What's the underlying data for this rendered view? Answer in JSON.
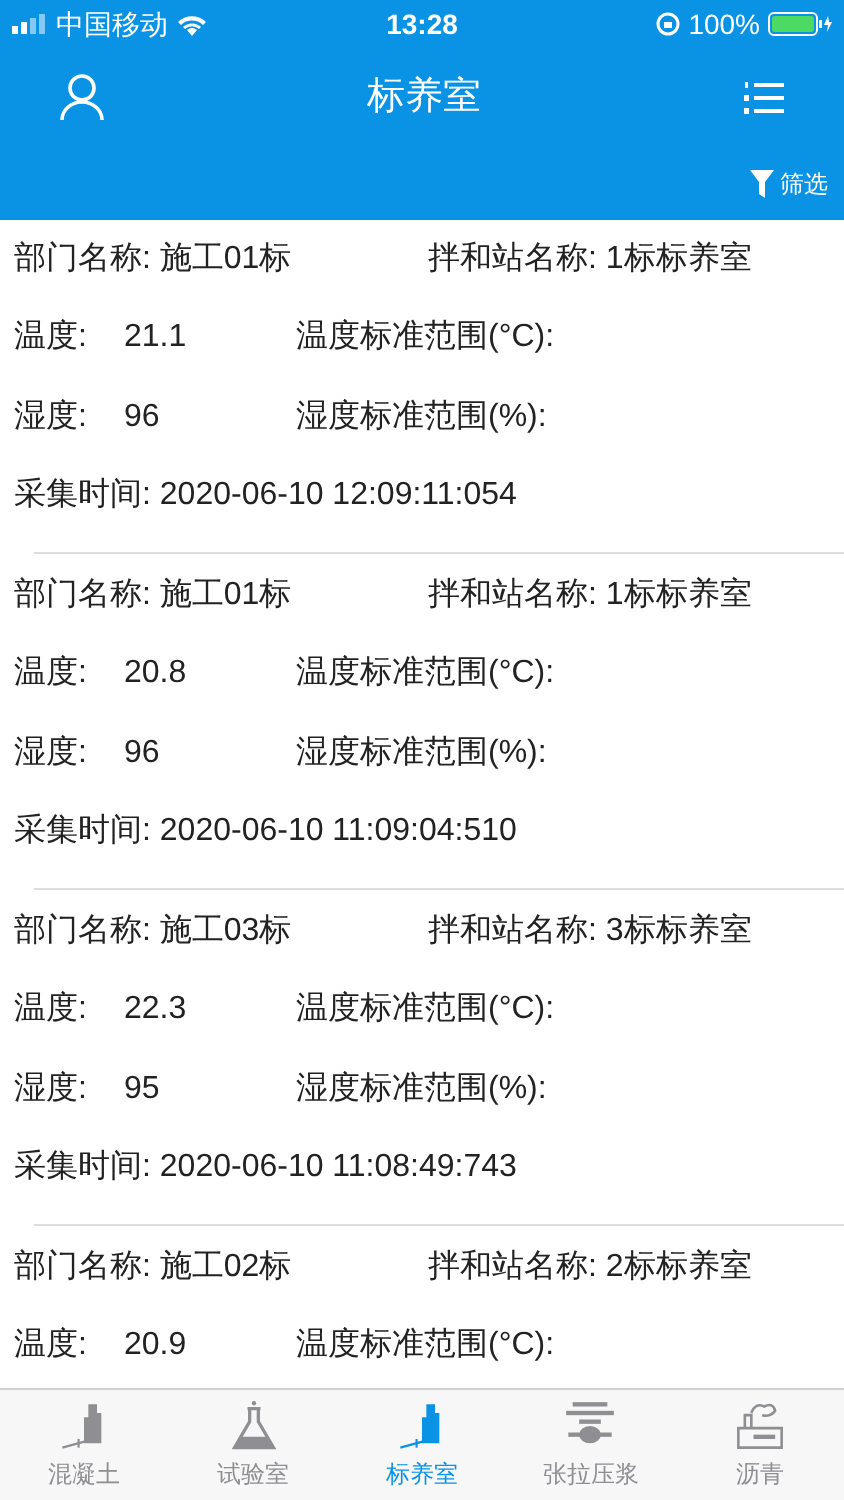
{
  "status_bar": {
    "carrier": "中国移动",
    "time": "13:28",
    "battery": "100%"
  },
  "nav": {
    "title": "标养室"
  },
  "filter": {
    "label": "筛选"
  },
  "records": [
    {
      "department": "部门名称: 施工01标",
      "station": "拌和站名称: 1标标养室",
      "temp_label": "温度:",
      "temp": "21.1",
      "temp_range": "温度标准范围(°C):",
      "hum_label": "湿度:",
      "hum": "96",
      "hum_range": "湿度标准范围(%):",
      "time": "采集时间: 2020-06-10 12:09:11:054"
    },
    {
      "department": "部门名称: 施工01标",
      "station": "拌和站名称: 1标标养室",
      "temp_label": "温度:",
      "temp": "20.8",
      "temp_range": "温度标准范围(°C):",
      "hum_label": "湿度:",
      "hum": "96",
      "hum_range": "湿度标准范围(%):",
      "time": "采集时间: 2020-06-10 11:09:04:510"
    },
    {
      "department": "部门名称: 施工03标",
      "station": "拌和站名称: 3标标养室",
      "temp_label": "温度:",
      "temp": "22.3",
      "temp_range": "温度标准范围(°C):",
      "hum_label": "湿度:",
      "hum": "95",
      "hum_range": "湿度标准范围(%):",
      "time": "采集时间: 2020-06-10 11:08:49:743"
    },
    {
      "department": "部门名称: 施工02标",
      "station": "拌和站名称: 2标标养室",
      "temp_label": "温度:",
      "temp": "20.9",
      "temp_range": "温度标准范围(°C):"
    }
  ],
  "tabs": [
    {
      "label": "混凝土",
      "kind": "plant",
      "selected": false
    },
    {
      "label": "试验室",
      "kind": "flask",
      "selected": false
    },
    {
      "label": "标养室",
      "kind": "plant",
      "selected": true
    },
    {
      "label": "张拉压浆",
      "kind": "press",
      "selected": false
    },
    {
      "label": "沥青",
      "kind": "factory",
      "selected": false
    }
  ]
}
